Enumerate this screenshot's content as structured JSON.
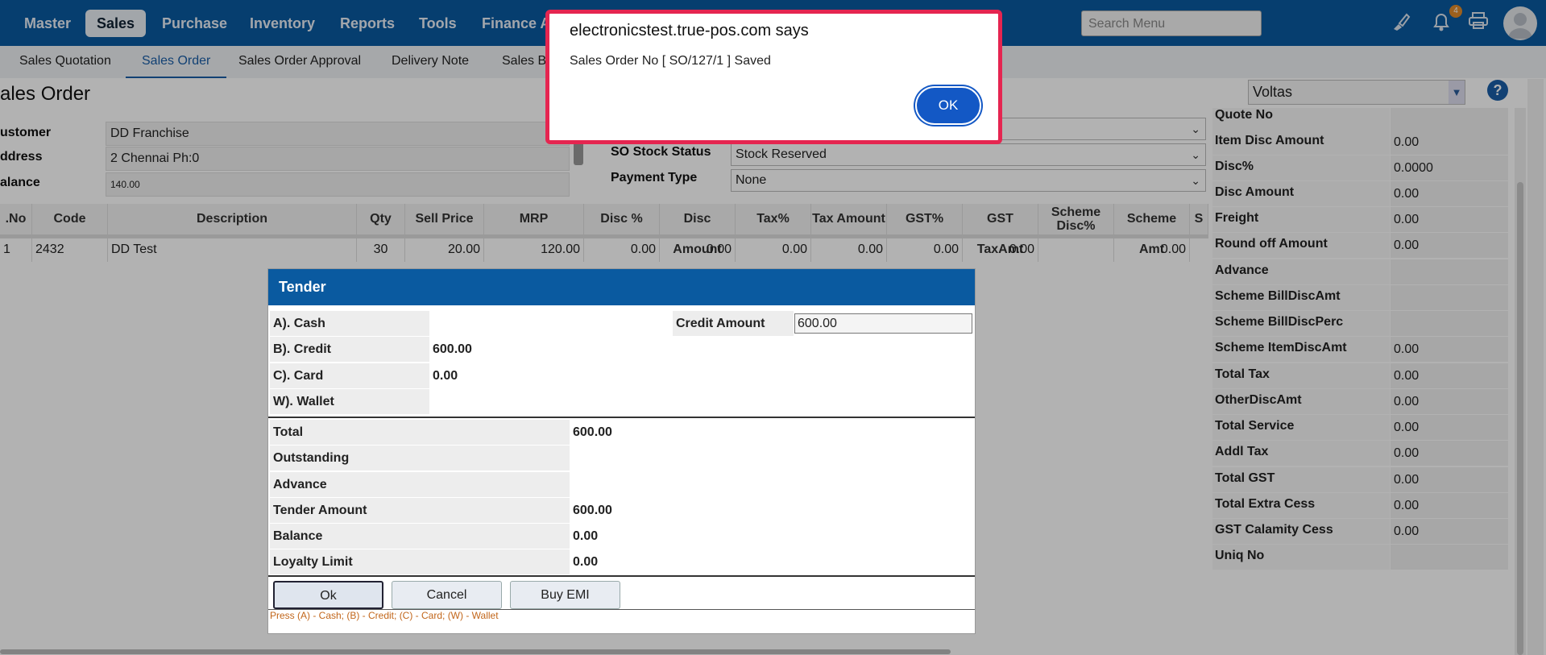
{
  "nav": {
    "items": [
      "Master",
      "Sales",
      "Purchase",
      "Inventory",
      "Reports",
      "Tools",
      "Finance Ac"
    ],
    "search_placeholder": "Search Menu",
    "notification_count": "4"
  },
  "subnav": {
    "items": [
      "Sales Quotation",
      "Sales Order",
      "Sales Order Approval",
      "Delivery Note",
      "Sales Bi"
    ]
  },
  "page": {
    "title": "ales Order",
    "company": "Voltas",
    "help_icon": "?"
  },
  "customer": {
    "customer_label": "ustomer",
    "customer_value": "DD Franchise",
    "address_label": "ddress",
    "address_value": "2 Chennai Ph:0",
    "balance_label": "alance",
    "balance_value": "140.00"
  },
  "order_fields": {
    "so_stock_status_label": "SO Stock Status",
    "so_stock_status_value": "Stock Reserved",
    "payment_type_label": "Payment Type",
    "payment_type_value": "None"
  },
  "grid": {
    "headers": [
      ".No",
      "Code",
      "Description",
      "Qty",
      "Sell Price",
      "MRP",
      "Disc %",
      "Disc Amount",
      "Tax%",
      "Tax Amount",
      "GST%",
      "GST TaxAmt",
      "Scheme Disc%",
      "Scheme Amt",
      "S"
    ],
    "rows": [
      [
        "1",
        "2432",
        "DD Test",
        "30",
        "20.00",
        "120.00",
        "0.00",
        "0.00",
        "0.00",
        "0.00",
        "0.00",
        "0.00",
        "",
        "0.00"
      ]
    ]
  },
  "right_panel": [
    {
      "label": "Quote No",
      "value": ""
    },
    {
      "label": "Item Disc Amount",
      "value": "0.00"
    },
    {
      "label": "Disc%",
      "value": "0.0000"
    },
    {
      "label": "Disc Amount",
      "value": "0.00"
    },
    {
      "label": "Freight",
      "value": "0.00"
    },
    {
      "label": "Round off Amount",
      "value": "0.00"
    },
    {
      "label": "Advance",
      "value": ""
    },
    {
      "label": "Scheme BillDiscAmt",
      "value": ""
    },
    {
      "label": "Scheme BillDiscPerc",
      "value": ""
    },
    {
      "label": "Scheme ItemDiscAmt",
      "value": "0.00"
    },
    {
      "label": "Total Tax",
      "value": "0.00"
    },
    {
      "label": "OtherDiscAmt",
      "value": "0.00"
    },
    {
      "label": "Total Service",
      "value": "0.00"
    },
    {
      "label": "Addl Tax",
      "value": "0.00"
    },
    {
      "label": "Total GST",
      "value": "0.00"
    },
    {
      "label": "Total Extra Cess",
      "value": "0.00"
    },
    {
      "label": "GST Calamity Cess",
      "value": "0.00"
    },
    {
      "label": "Uniq No",
      "value": ""
    }
  ],
  "tender": {
    "title": "Tender",
    "payments": [
      {
        "label": "A). Cash",
        "value": ""
      },
      {
        "label": "B). Credit",
        "value": "600.00"
      },
      {
        "label": "C). Card",
        "value": "0.00"
      },
      {
        "label": "W). Wallet",
        "value": ""
      }
    ],
    "credit_amount_label": "Credit Amount",
    "credit_amount_value": "600.00",
    "summary": [
      {
        "label": "Total",
        "value": "600.00"
      },
      {
        "label": "Outstanding",
        "value": ""
      },
      {
        "label": "Advance",
        "value": ""
      },
      {
        "label": "Tender Amount",
        "value": "600.00"
      },
      {
        "label": "Balance",
        "value": "0.00"
      },
      {
        "label": "Loyalty Limit",
        "value": "0.00"
      }
    ],
    "ok_label": "Ok",
    "cancel_label": "Cancel",
    "emi_label": "Buy EMI",
    "hint": "Press (A) - Cash; (B) - Credit; (C) - Card; (W) - Wallet"
  },
  "alert": {
    "title": "electronicstest.true-pos.com says",
    "message": "Sales Order No [ SO/127/1 ] Saved",
    "ok_label": "OK"
  }
}
